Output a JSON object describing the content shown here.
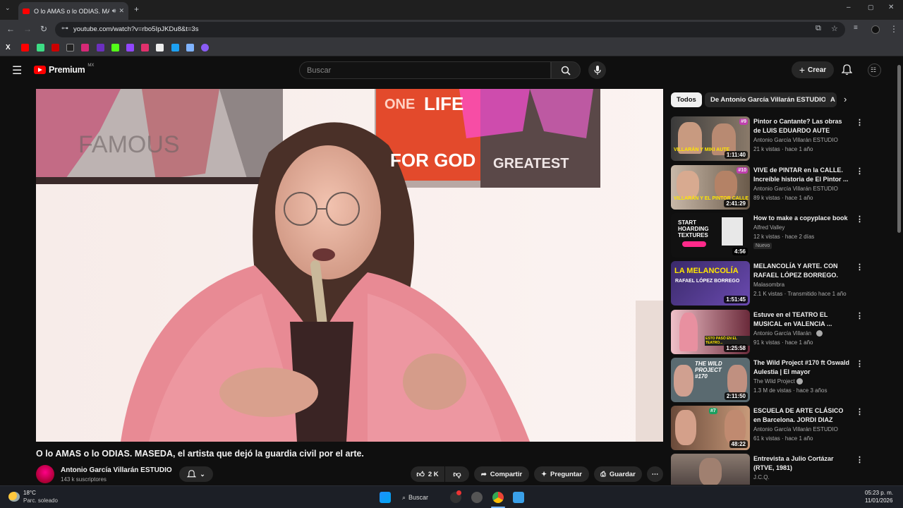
{
  "browser": {
    "tab_title": "O lo AMAS o lo ODIAS. MA",
    "url": "youtube.com/watch?v=rbo5IpJKDu8&t=3s"
  },
  "yt": {
    "logo_text": "Premium",
    "logo_region": "MX",
    "search_placeholder": "Buscar",
    "create_label": "Crear"
  },
  "video": {
    "sign_one": "ONE",
    "sign_life": "LIFE",
    "sign_forgod": "FOR GOD",
    "sign_greatest": "GREATEST",
    "wall_text": "FAMOUS",
    "title": "O lo AMAS o lo ODIAS. MASEDA, el artista que dejó la guardia civil por el arte.",
    "channel": "Antonio García Villarán ESTUDIO",
    "subscribers": "143 k suscriptores",
    "likes": "2 K",
    "share_label": "Compartir",
    "ask_label": "Preguntar",
    "save_label": "Guardar"
  },
  "chips": [
    "Todos",
    "De Antonio García Villarán ESTUDIO",
    "A"
  ],
  "recommendations": [
    {
      "title": "Pintor o Cantante? Las obras de LUIS EDUARDO AUTE contada...",
      "channel": "Antonio García Villarán ESTUDIO",
      "meta": "21 k vistas · hace 1 año",
      "duration": "1:11:40",
      "thumb_text": "VILLARÁN Y MIKI AUTE",
      "thumb_tag": "#9"
    },
    {
      "title": "VIVE de PINTAR en la CALLE. Increíble historia de El Pintor ...",
      "channel": "Antonio García Villarán ESTUDIO",
      "meta": "89 k vistas · hace 1 año",
      "duration": "2:41:29",
      "thumb_text": "VILLARÁN Y EL PINTOR CALLE",
      "thumb_tag": "#10"
    },
    {
      "title": "How to make a copyplace book",
      "channel": "Alfred Valley",
      "meta": "12 k vistas · hace 2 días",
      "duration": "4:56",
      "badge": "Nuevo",
      "thumb_text": "START HOARDING TEXTURES"
    },
    {
      "title": "MELANCOLÍA Y ARTE. CON RAFAEL LÓPEZ BORREGO.",
      "channel": "Malasombra",
      "meta": "2.1 K vistas · Transmitido hace 1 año",
      "duration": "1:51:45",
      "thumb_text": "LA MELANCOLÍA",
      "thumb_text2": "RAFAEL LÓPEZ BORREGO"
    },
    {
      "title": "Estuve en el TEATRO EL MUSICAL en VALENCIA ...",
      "channel": "Antonio García Villarán",
      "meta": "91 k vistas · hace 1 año",
      "duration": "1:25:58",
      "thumb_text": "ESTO PASÓ EN EL TEATRO..."
    },
    {
      "title": "The Wild Project #170 ft Oswald Aulestia | El mayor falsificador...",
      "channel": "The Wild Project",
      "meta": "1.3 M de vistas · hace 3 años",
      "duration": "2:11:50",
      "thumb_text": "THE WILD PROJECT #170"
    },
    {
      "title": "ESCUELA DE ARTE CLÁSICO en Barcelona. JORDI DIAZ ALAM...",
      "channel": "Antonio García Villarán ESTUDIO",
      "meta": "61 k vistas · hace 1 año",
      "duration": "48:22",
      "thumb_tag": "#7"
    },
    {
      "title": "Entrevista a Julio Cortázar (RTVE, 1981)",
      "channel": "J.C.Q.",
      "meta": "",
      "duration": ""
    }
  ],
  "taskbar": {
    "temp": "18°C",
    "weather": "Parc. soleado",
    "search_label": "Buscar",
    "time": "05:23 p. m.",
    "date": "11/01/2026"
  }
}
